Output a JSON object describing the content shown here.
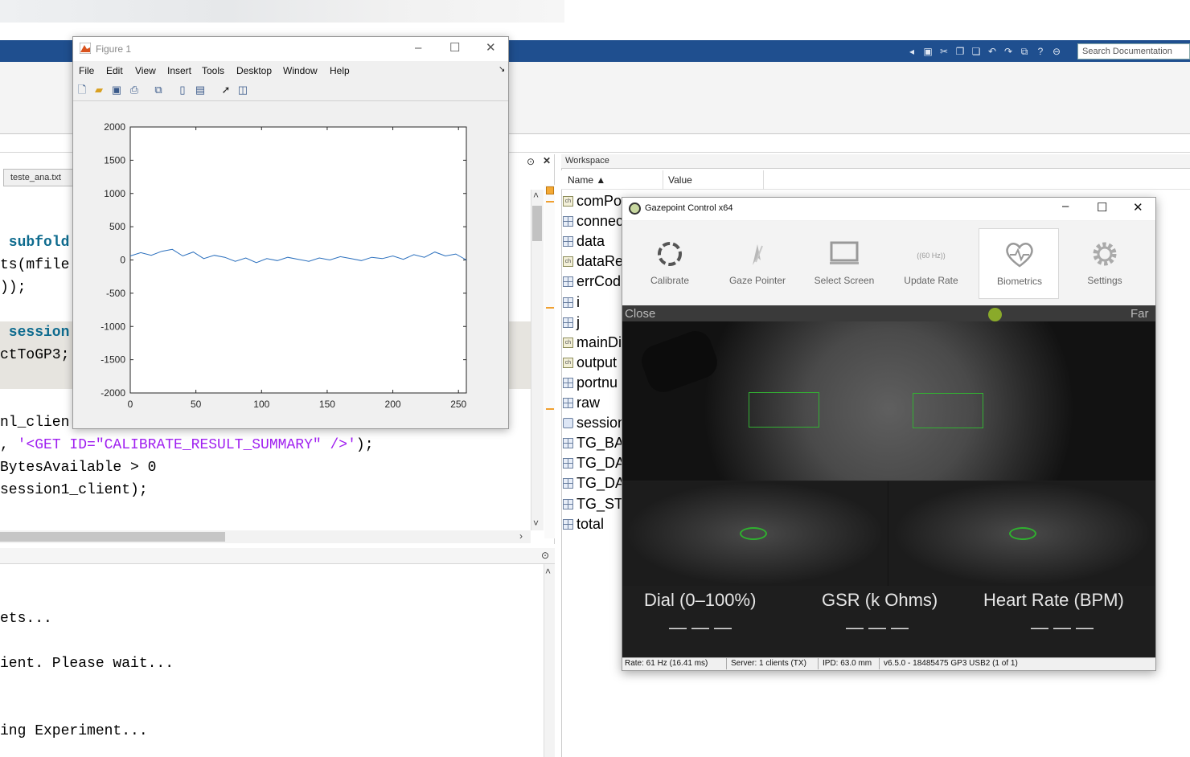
{
  "matlab": {
    "search_placeholder": "Search Documentation",
    "editor_tab": "teste_ana.txt",
    "code_lines": [
      {
        "plain": " subfold",
        "style": "kw"
      },
      {
        "plain": "ts(mfile",
        "style": "plain"
      },
      {
        "plain": "));",
        "style": "plain"
      },
      {
        "plain": " session",
        "style": "kw"
      },
      {
        "plain": "ctToGP3;",
        "style": "plain"
      },
      {
        "plain": "nl_clien",
        "style": "plain"
      },
      {
        "a": ", ",
        "b": "'<GET ID=\"CALIBRATE_RESULT_SUMMARY\" />'",
        "c": ");"
      },
      {
        "plain": "BytesAvailable > 0",
        "style": "plain"
      },
      {
        "plain": "session1_client);",
        "style": "plain"
      }
    ],
    "command_lines": [
      "ets...",
      "ient. Please wait...",
      "ing Experiment..."
    ]
  },
  "workspace": {
    "title": "Workspace",
    "col_name": "Name ▲",
    "col_value": "Value",
    "rows": [
      {
        "name": "comPo",
        "icon": "char"
      },
      {
        "name": "connec",
        "icon": "grid"
      },
      {
        "name": "data",
        "icon": "grid"
      },
      {
        "name": "dataRe",
        "icon": "char"
      },
      {
        "name": "errCod",
        "icon": "grid"
      },
      {
        "name": "i",
        "icon": "grid"
      },
      {
        "name": "j",
        "icon": "grid"
      },
      {
        "name": "mainDi",
        "icon": "char"
      },
      {
        "name": "output",
        "icon": "char"
      },
      {
        "name": "portnu",
        "icon": "grid"
      },
      {
        "name": "raw",
        "icon": "grid"
      },
      {
        "name": "session",
        "icon": "obj"
      },
      {
        "name": "TG_BAU",
        "icon": "grid"
      },
      {
        "name": "TG_DAT",
        "icon": "grid"
      },
      {
        "name": "TG_DAT",
        "icon": "grid"
      },
      {
        "name": "TG_STR",
        "icon": "grid"
      },
      {
        "name": "total",
        "icon": "grid"
      }
    ]
  },
  "figure": {
    "title": "Figure 1",
    "menu": [
      "File",
      "Edit",
      "View",
      "Insert",
      "Tools",
      "Desktop",
      "Window",
      "Help"
    ]
  },
  "chart_data": {
    "type": "line",
    "title": "",
    "xlabel": "",
    "ylabel": "",
    "xlim": [
      0,
      256
    ],
    "ylim": [
      -2000,
      2000
    ],
    "xticks": [
      0,
      50,
      100,
      150,
      200,
      250
    ],
    "yticks": [
      2000,
      1500,
      1000,
      500,
      0,
      -500,
      -1000,
      -1500,
      -2000
    ],
    "grid": false,
    "series": [
      {
        "color": "#2a6fbd",
        "x": [
          0,
          8,
          16,
          24,
          32,
          40,
          48,
          56,
          64,
          72,
          80,
          88,
          96,
          104,
          112,
          120,
          128,
          136,
          144,
          152,
          160,
          168,
          176,
          184,
          192,
          200,
          208,
          216,
          224,
          232,
          240,
          248,
          256
        ],
        "y": [
          60,
          110,
          70,
          130,
          160,
          60,
          120,
          20,
          70,
          40,
          -20,
          30,
          -40,
          20,
          -10,
          40,
          10,
          -20,
          30,
          0,
          50,
          20,
          -10,
          40,
          20,
          60,
          10,
          80,
          40,
          120,
          60,
          90,
          0
        ]
      }
    ]
  },
  "gazepoint": {
    "title": "Gazepoint Control x64",
    "buttons": [
      {
        "label": "Calibrate"
      },
      {
        "label": "Gaze Pointer"
      },
      {
        "label": "Select Screen"
      },
      {
        "label": "Update Rate",
        "badge": "60 Hz"
      },
      {
        "label": "Biometrics"
      },
      {
        "label": "Settings"
      }
    ],
    "range_close": "Close",
    "range_far": "Far",
    "bio": {
      "dial_label": "Dial (0–100%)",
      "gsr_label": "GSR (k Ohms)",
      "hr_label": "Heart Rate (BPM)",
      "dial_value": "———",
      "gsr_value": "———",
      "hr_value": "———"
    },
    "status": {
      "rate": "Rate: 61 Hz (16.41 ms)",
      "server": "Server: 1 clients (TX)",
      "ipd": "IPD: 63.0 mm",
      "version": "v6.5.0 - 18485475 GP3 USB2 (1 of 1)"
    }
  }
}
